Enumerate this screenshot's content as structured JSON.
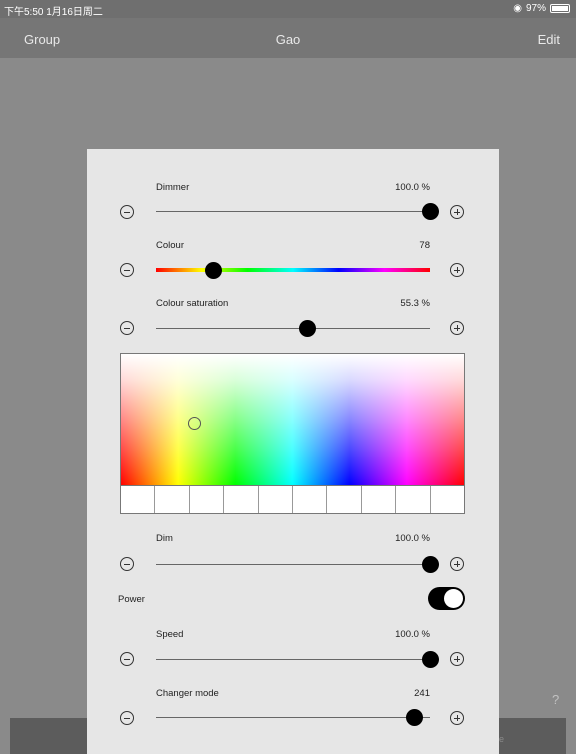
{
  "status_bar": {
    "time": "下午5:50",
    "date": "1月16日周二",
    "battery": "97%"
  },
  "navbar": {
    "back_label": "Group",
    "title": "Gao",
    "edit_label": "Edit"
  },
  "help_label": "?",
  "tabbar": {
    "partial_label": "re"
  },
  "controls": {
    "dimmer": {
      "label": "Dimmer",
      "value": "100.0 %",
      "level": 1.0
    },
    "colour": {
      "label": "Colour",
      "value": "78",
      "level": 0.21
    },
    "colour_saturation": {
      "label": "Colour saturation",
      "value": "55.3 %",
      "level": 0.553
    },
    "dim": {
      "label": "Dim",
      "value": "100.0 %",
      "level": 1.0
    },
    "power": {
      "label": "Power",
      "state": "on"
    },
    "speed": {
      "label": "Speed",
      "value": "100.0 %",
      "level": 1.0
    },
    "changer_mode": {
      "label": "Changer mode",
      "value": "241",
      "level": 0.945
    }
  },
  "palette": {
    "swatch_count": 10,
    "picker_hue_fraction": 0.21
  }
}
